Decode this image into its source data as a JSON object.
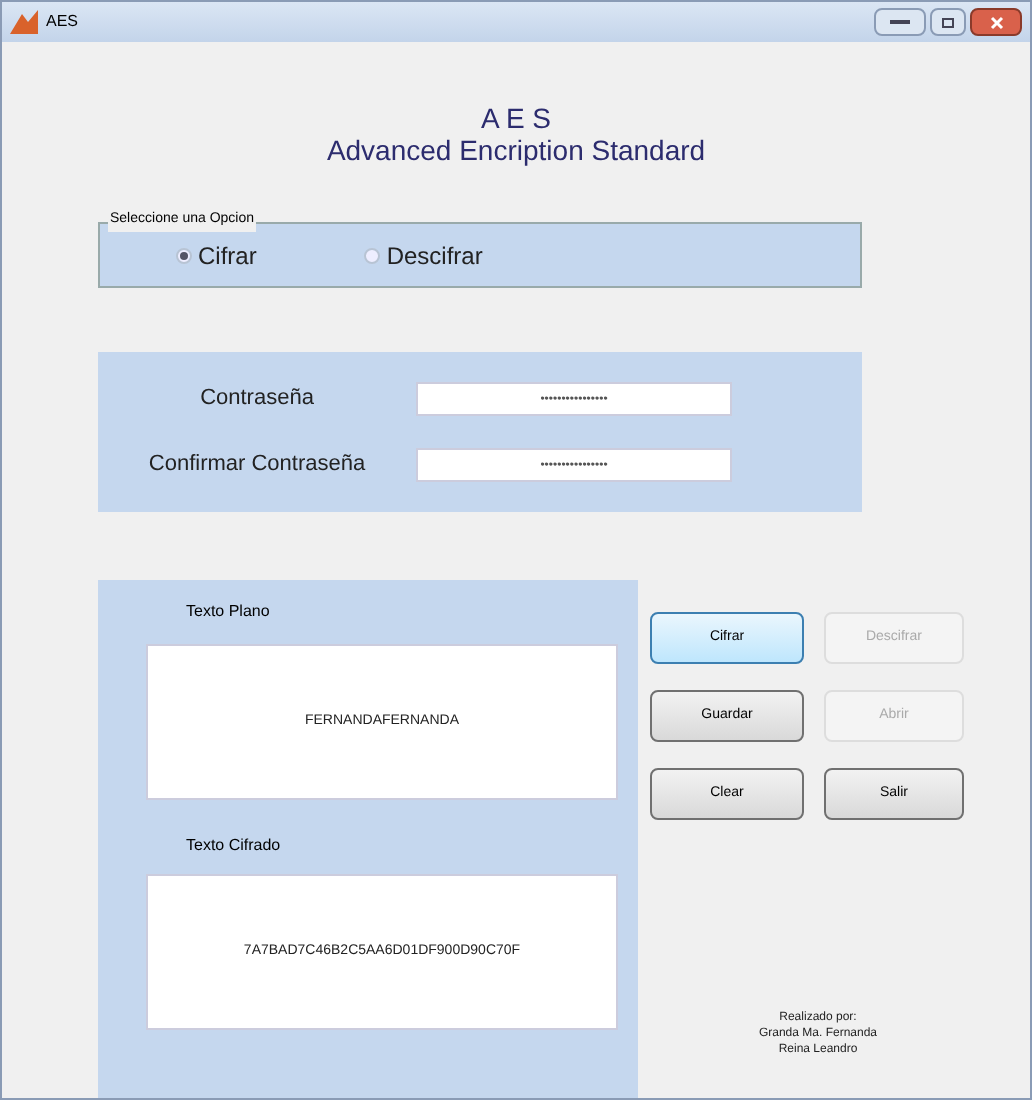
{
  "window": {
    "title": "AES"
  },
  "heading": {
    "title": "A E S",
    "subtitle": "Advanced Encription Standard"
  },
  "option_group": {
    "label": "Seleccione una Opcion",
    "options": [
      {
        "label": "Cifrar",
        "selected": true
      },
      {
        "label": "Descifrar",
        "selected": false
      }
    ]
  },
  "password_fields": [
    {
      "label": "Contraseña",
      "value": "••••••••••••••••"
    },
    {
      "label": "Confirmar Contraseña",
      "value": "••••••••••••••••"
    }
  ],
  "plain_text": {
    "label": "Texto Plano",
    "value": "FERNANDAFERNANDA"
  },
  "cipher_text": {
    "label": "Texto Cifrado",
    "value": "7A7BAD7C46B2C5AA6D01DF900D90C70F"
  },
  "buttons": [
    {
      "label": "Cifrar",
      "focused": true,
      "disabled": false
    },
    {
      "label": "Descifrar",
      "focused": false,
      "disabled": true
    },
    {
      "label": "Guardar",
      "focused": false,
      "disabled": false
    },
    {
      "label": "Abrir",
      "focused": false,
      "disabled": true
    },
    {
      "label": "Clear",
      "focused": false,
      "disabled": false
    },
    {
      "label": "Salir",
      "focused": false,
      "disabled": false
    }
  ],
  "credits": [
    "Realizado por:",
    "Granda Ma. Fernanda",
    "Reina Leandro"
  ]
}
